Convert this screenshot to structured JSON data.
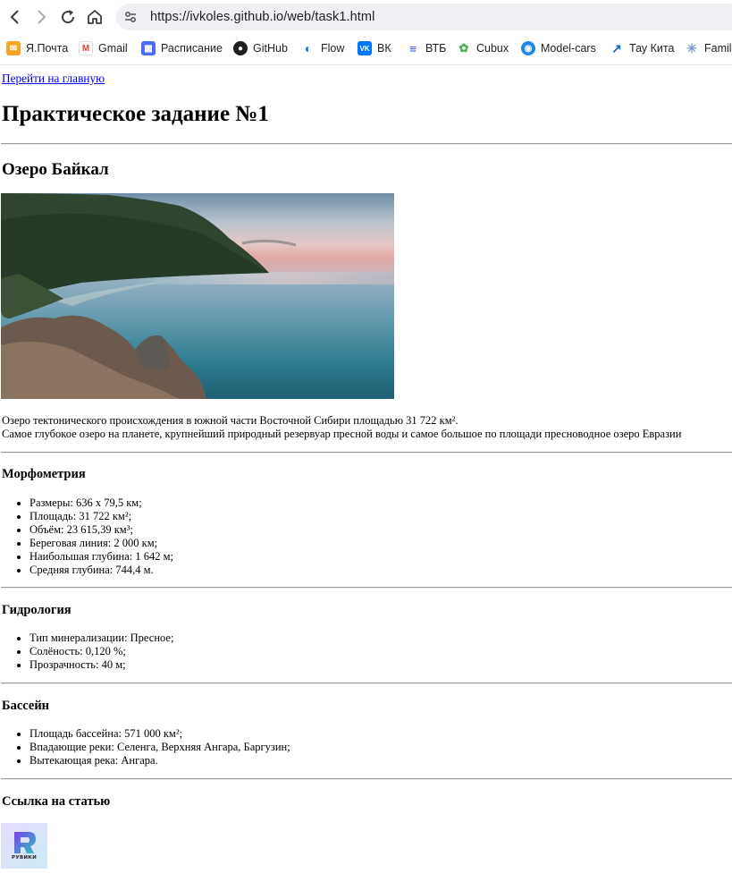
{
  "browser": {
    "url": "https://ivkoles.github.io/web/task1.html",
    "bookmarks": [
      {
        "label": "Я.Почта",
        "icon": "yandex-mail-icon",
        "color": "#f5a623"
      },
      {
        "label": "Gmail",
        "icon": "gmail-icon",
        "color": "#ea4335"
      },
      {
        "label": "Расписание",
        "icon": "calendar-icon",
        "color": "#4a6cf7"
      },
      {
        "label": "GitHub",
        "icon": "github-icon",
        "color": "#1f1f1f"
      },
      {
        "label": "Flow",
        "icon": "flow-icon",
        "color": "#1a73e8"
      },
      {
        "label": "ВК",
        "icon": "vk-icon",
        "color": "#0077ff"
      },
      {
        "label": "ВТБ",
        "icon": "vtb-icon",
        "color": "#2a4bd7"
      },
      {
        "label": "Cubux",
        "icon": "cubux-icon",
        "color": "#4caf50"
      },
      {
        "label": "Model-cars",
        "icon": "model-cars-icon",
        "color": "#1e88e5"
      },
      {
        "label": "Тау Кита",
        "icon": "tau-kita-icon",
        "color": "#1565c0"
      },
      {
        "label": "Famili",
        "icon": "family-icon",
        "color": "#7e9cc9"
      }
    ]
  },
  "page": {
    "home_link": "Перейти на главную",
    "title": "Практическое задание №1",
    "subtitle": "Озеро Байкал",
    "description": [
      "Озеро тектонического происхождения в южной части Восточной Сибири площадью 31 722 км².",
      "Самое глубокое озеро на планете, крупнейший природный резервуар пресной воды и самое большое по площади пресноводное озеро Евразии"
    ],
    "sections": [
      {
        "heading": "Морфометрия",
        "items": [
          "Размеры: 636 х 79,5 км;",
          "Площадь: 31 722 км²;",
          "Объём: 23 615,39 км³;",
          "Береговая линия: 2 000 км;",
          "Наибольшая глубина: 1 642 м;",
          "Средняя глубина: 744,4 м."
        ]
      },
      {
        "heading": "Гидрология",
        "items": [
          "Тип минерализации: Пресное;",
          "Солёность: 0,120 %;",
          "Прозрачность: 40 м;"
        ]
      },
      {
        "heading": "Бассейн",
        "items": [
          "Площадь бассейна: 571 000 км²;",
          "Впадающие реки: Селенга, Верхняя Ангара, Баргузин;",
          "Вытекающая река: Ангара."
        ]
      }
    ],
    "article_heading": "Ссылка на статью",
    "article_logo_text": "РУВИКИ"
  }
}
